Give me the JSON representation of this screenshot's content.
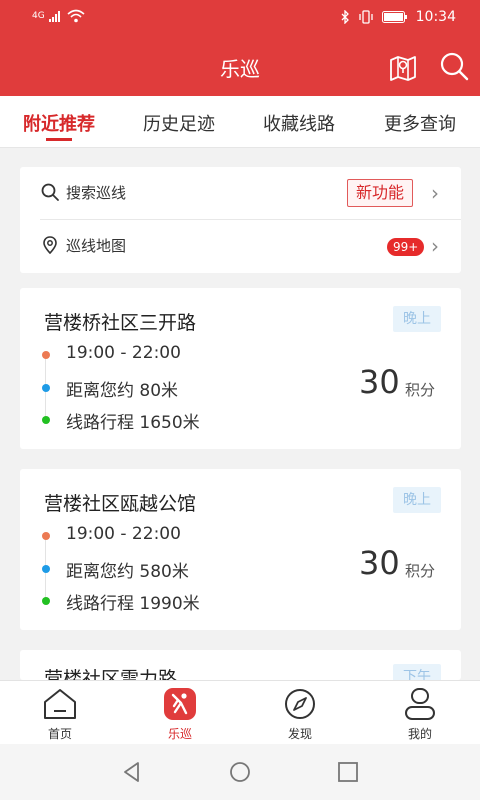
{
  "statusbar": {
    "network": "4G",
    "time": "10:34",
    "icons": [
      "signal-icon",
      "wifi-icon",
      "bluetooth-icon",
      "vibrate-icon",
      "battery-icon"
    ]
  },
  "appbar": {
    "title": "乐巡"
  },
  "tabs": [
    {
      "label": "附近推荐",
      "active": true
    },
    {
      "label": "历史足迹"
    },
    {
      "label": "收藏线路"
    },
    {
      "label": "更多查询"
    }
  ],
  "entries": {
    "search": {
      "label": "搜索巡线",
      "badge": "新功能"
    },
    "map": {
      "label": "巡线地图",
      "badge": "99+"
    }
  },
  "routes": [
    {
      "title": "营楼桥社区三开路",
      "period": "晚上",
      "time": "19:00 - 22:00",
      "distance": "距离您约 80米",
      "length": "线路行程 1650米",
      "points": "30",
      "points_unit": "积分"
    },
    {
      "title": "营楼社区瓯越公馆",
      "period": "晚上",
      "time": "19:00 - 22:00",
      "distance": "距离您约 580米",
      "length": "线路行程 1990米",
      "points": "30",
      "points_unit": "积分"
    },
    {
      "title": "营楼社区雷力路",
      "period": "下午"
    }
  ],
  "bottom_nav": [
    {
      "label": "首页",
      "icon": "home-icon"
    },
    {
      "label": "乐巡",
      "icon": "patrol-icon",
      "active": true
    },
    {
      "label": "发现",
      "icon": "compass-icon"
    },
    {
      "label": "我的",
      "icon": "profile-icon"
    }
  ],
  "colors": {
    "brand": "#e03c3c",
    "accent": "#d7292b",
    "dot_time": "#ec7a53",
    "dot_distance": "#1e9be6",
    "dot_length": "#22c022"
  }
}
